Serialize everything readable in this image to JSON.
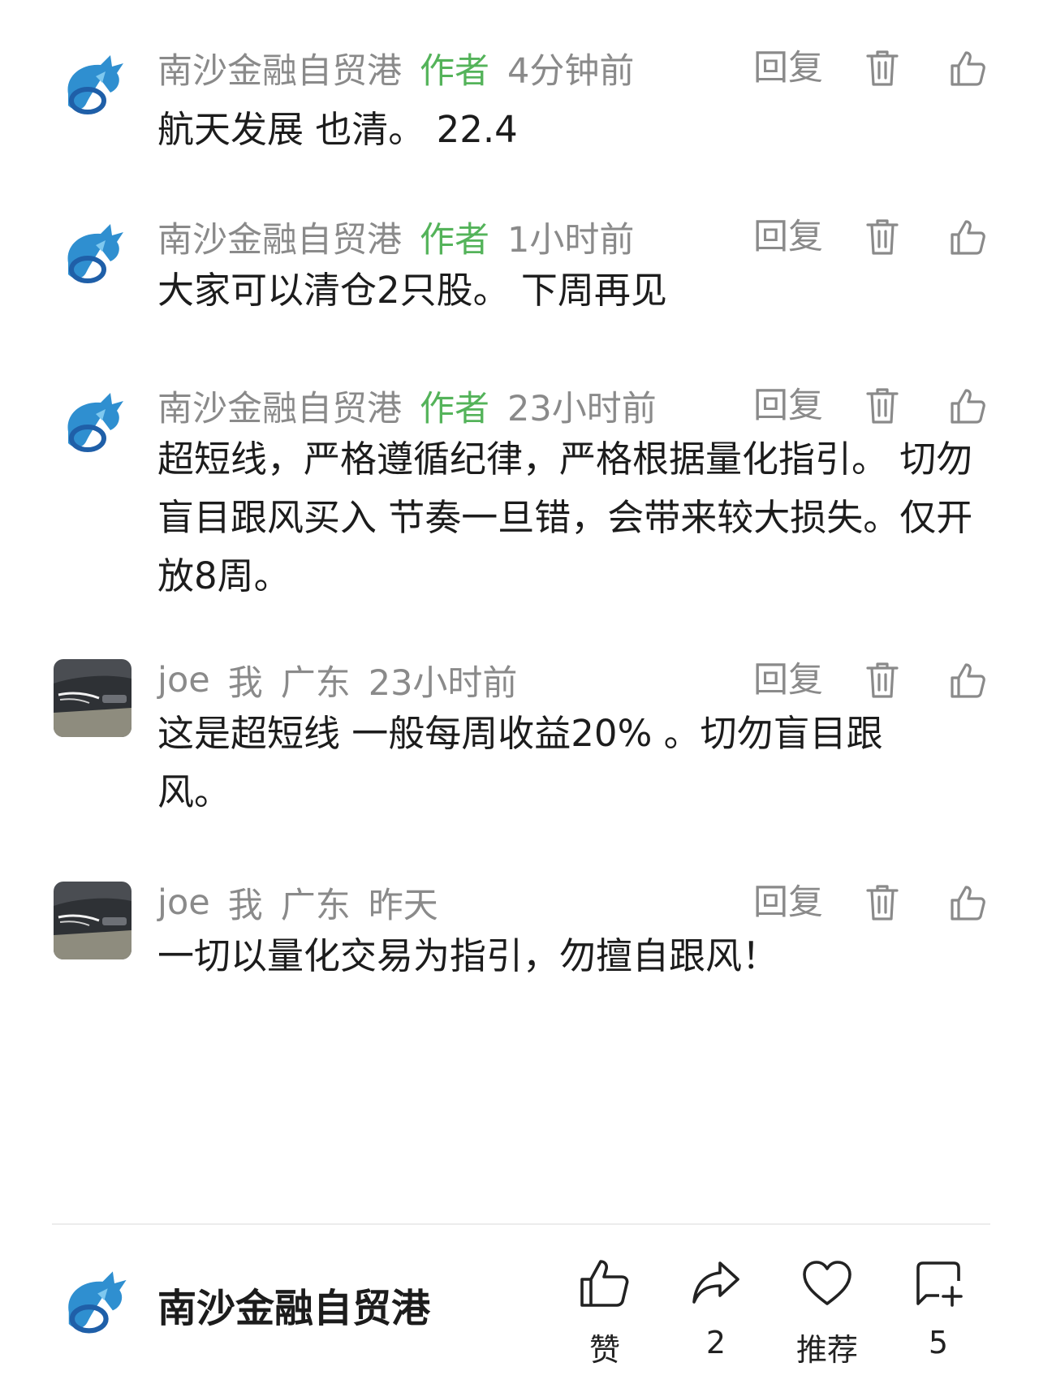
{
  "comments": [
    {
      "user": "南沙金融自贸港",
      "tag": "作者",
      "time": "4分钟前",
      "text": "航天发展 也清。 22.4",
      "reply_label": "回复",
      "avatar_icon": "dragon-logo-icon"
    },
    {
      "user": "南沙金融自贸港",
      "tag": "作者",
      "time": "1小时前",
      "text": "大家可以清仓2只股。 下周再见",
      "reply_label": "回复",
      "avatar_icon": "dragon-logo-icon"
    },
    {
      "user": "南沙金融自贸港",
      "tag": "作者",
      "time": "23小时前",
      "text": "超短线，严格遵循纪律，严格根据量化指引。 切勿盲目跟风买入 节奏一旦错，会带来较大损失。仅开放8周。",
      "reply_label": "回复",
      "avatar_icon": "dragon-logo-icon"
    },
    {
      "user": "joe",
      "tag": "我",
      "location": "广东",
      "time": "23小时前",
      "text": "这是超短线 一般每周收益20% 。切勿盲目跟风。",
      "reply_label": "回复",
      "avatar_icon": "car-photo-icon"
    },
    {
      "user": "joe",
      "tag": "我",
      "location": "广东",
      "time": "昨天",
      "text": "一切以量化交易为指引，勿擅自跟风！",
      "reply_label": "回复",
      "avatar_icon": "car-photo-icon"
    }
  ],
  "footer": {
    "name": "南沙金融自贸港",
    "like_label": "赞",
    "share_count": "2",
    "recommend_label": "推荐",
    "comment_count": "5"
  },
  "colors": {
    "author_tag": "#54b35a",
    "meta": "#8a8a8a",
    "text": "#1c1c1c"
  }
}
